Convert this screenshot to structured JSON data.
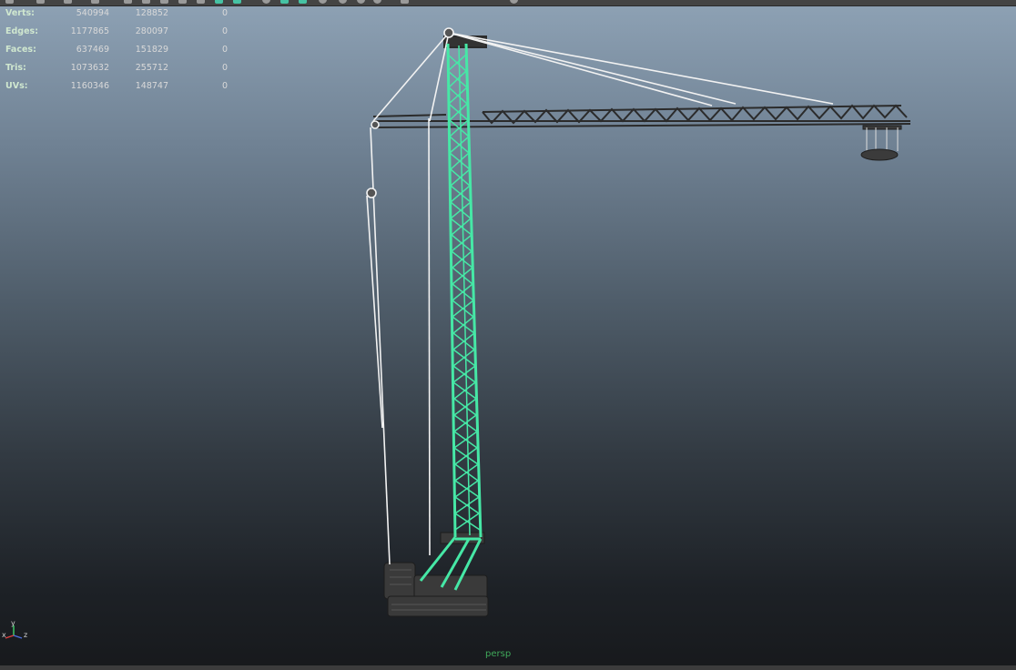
{
  "toolbar": {
    "icons": [
      "select-tool",
      "lasso-tool",
      "paint-tool",
      "move-tool",
      "grid-view",
      "single-view",
      "four-view",
      "outliner",
      "shaded",
      "wireframe",
      "textured",
      "camera",
      "light",
      "selected-tool",
      "shadow",
      "snap",
      "render",
      "ipr",
      "settings",
      "close"
    ]
  },
  "stats": {
    "rows": [
      {
        "label": "Verts:",
        "v1": "540994",
        "v2": "128852",
        "v3": "0"
      },
      {
        "label": "Edges:",
        "v1": "1177865",
        "v2": "280097",
        "v3": "0"
      },
      {
        "label": "Faces:",
        "v1": "637469",
        "v2": "151829",
        "v3": "0"
      },
      {
        "label": "Tris:",
        "v1": "1073632",
        "v2": "255712",
        "v3": "0"
      },
      {
        "label": "UVs:",
        "v1": "1160346",
        "v2": "148747",
        "v3": "0"
      }
    ]
  },
  "viewport": {
    "camera": "persp",
    "selection_color": "#46e8a6",
    "cable_color": "#f2f2f2",
    "steel_color": "#2e2e2e"
  },
  "axis": {
    "x": "x",
    "y": "y",
    "z": "z"
  }
}
